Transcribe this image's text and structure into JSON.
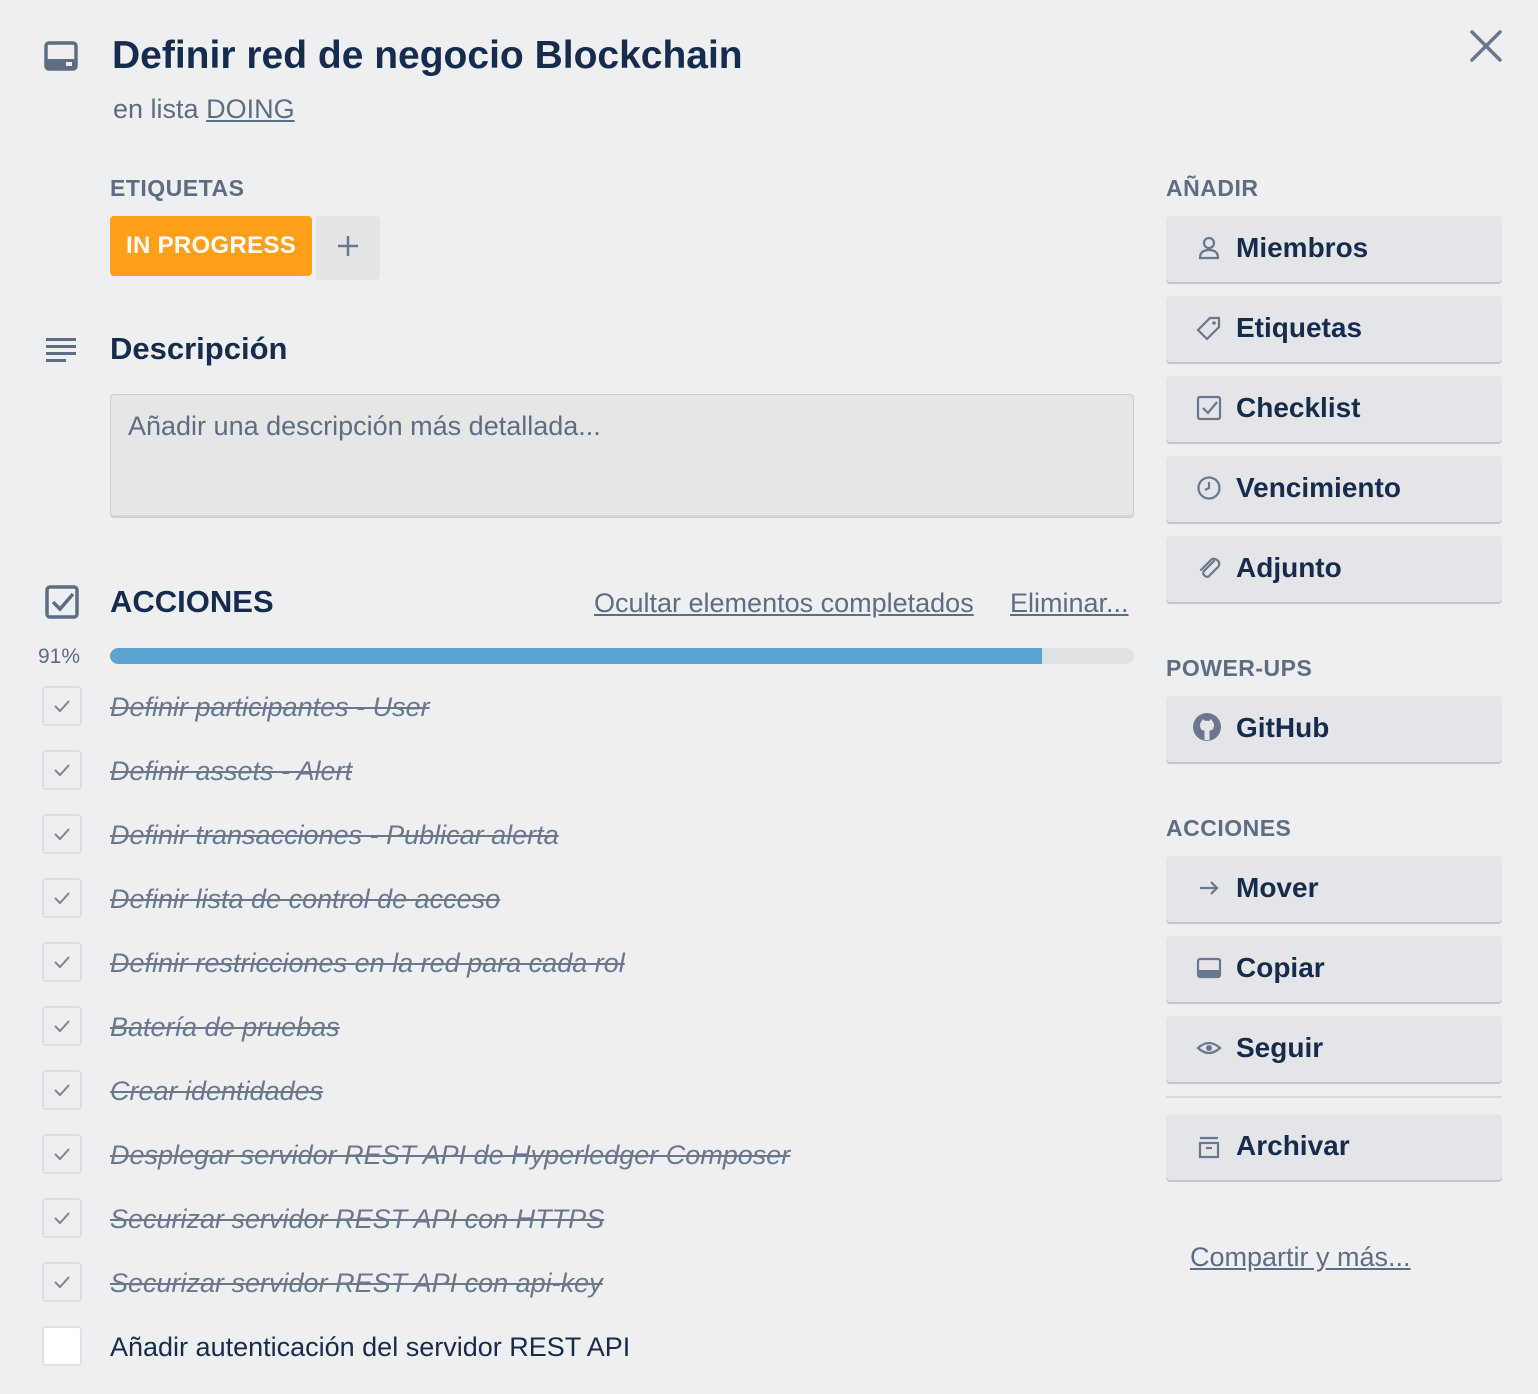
{
  "card": {
    "title": "Definir red de negocio Blockchain",
    "list_prefix": "en lista",
    "list_name": "DOING",
    "icon": "card-icon",
    "close_icon": "close-icon"
  },
  "labels_section": {
    "heading": "ETIQUETAS",
    "labels": [
      {
        "text": "IN PROGRESS",
        "color": "#ff9f1a"
      }
    ],
    "add_icon": "plus-icon"
  },
  "description": {
    "heading": "Descripción",
    "placeholder": "Añadir una descripción más detallada...",
    "icon": "description-lines-icon"
  },
  "checklist": {
    "title": "ACCIONES",
    "hide_link": "Ocultar elementos completados",
    "delete_link": "Eliminar...",
    "percent_label": "91%",
    "progress": 0.91,
    "progress_color": "#5ba4cf",
    "items": [
      {
        "text": "Definir participantes - User",
        "done": true
      },
      {
        "text": "Definir assets - Alert",
        "done": true
      },
      {
        "text": "Definir transacciones - Publicar alerta",
        "done": true
      },
      {
        "text": "Definir lista de control de acceso",
        "done": true
      },
      {
        "text": "Definir restricciones en la red para cada rol",
        "done": true
      },
      {
        "text": "Batería de pruebas",
        "done": true
      },
      {
        "text": "Crear identidades",
        "done": true
      },
      {
        "text": "Desplegar servidor REST API de Hyperledger Composer",
        "done": true
      },
      {
        "text": "Securizar servidor REST API con HTTPS",
        "done": true
      },
      {
        "text": "Securizar servidor REST API con api-key",
        "done": true
      },
      {
        "text": "Añadir autenticación del servidor REST API",
        "done": false
      }
    ]
  },
  "sidebar": {
    "add_heading": "AÑADIR",
    "add_buttons": [
      {
        "label": "Miembros",
        "icon": "person-icon"
      },
      {
        "label": "Etiquetas",
        "icon": "tag-icon"
      },
      {
        "label": "Checklist",
        "icon": "checkbox-icon"
      },
      {
        "label": "Vencimiento",
        "icon": "clock-icon"
      },
      {
        "label": "Adjunto",
        "icon": "paperclip-icon"
      }
    ],
    "powerups_heading": "POWER-UPS",
    "powerups": [
      {
        "label": "GitHub",
        "icon": "github-icon"
      }
    ],
    "actions_heading": "ACCIONES",
    "actions": [
      {
        "label": "Mover",
        "icon": "arrow-right-icon"
      },
      {
        "label": "Copiar",
        "icon": "card-icon"
      },
      {
        "label": "Seguir",
        "icon": "eye-icon"
      }
    ],
    "archive": {
      "label": "Archivar",
      "icon": "archive-icon"
    },
    "share_link": "Compartir y más..."
  }
}
